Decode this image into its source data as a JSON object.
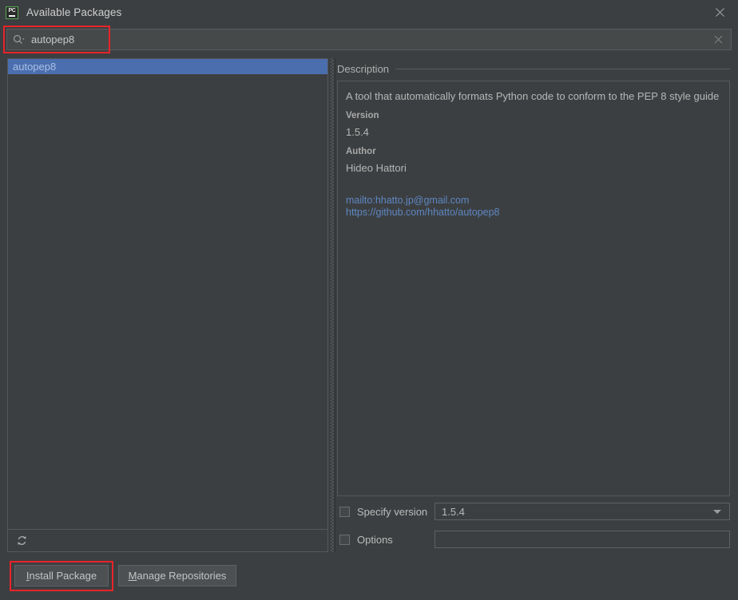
{
  "window": {
    "title": "Available Packages",
    "app_icon": "pycharm-icon",
    "app_icon_text": "PC",
    "close_icon": "close-icon",
    "background_color": "#3c3f41"
  },
  "search": {
    "icon": "search-icon",
    "value": "autopep8",
    "placeholder": "",
    "clear_icon": "clear-icon",
    "highlight_color": "#e8242a"
  },
  "package_list": {
    "items": [
      {
        "label": "autopep8",
        "selected": true
      }
    ],
    "selection_color": "#4b6eaf",
    "toolbar": {
      "refresh_icon": "refresh-icon"
    }
  },
  "description": {
    "header_label": "Description",
    "summary": "A tool that automatically formats Python code to conform to the PEP 8 style guide",
    "fields": [
      {
        "label": "Version",
        "value": "1.5.4"
      },
      {
        "label": "Author",
        "value": "Hideo Hattori"
      }
    ],
    "links": [
      "mailto:hhatto.jp@gmail.com",
      "https://github.com/hhatto/autopep8"
    ],
    "link_color": "#5e87c4"
  },
  "options": {
    "specify_version": {
      "label": "Specify version",
      "checked": false,
      "value": "1.5.4"
    },
    "options_field": {
      "label": "Options",
      "checked": false,
      "value": ""
    }
  },
  "buttons": {
    "install": {
      "mnemonic": "I",
      "rest": "nstall Package",
      "highlighted": true
    },
    "manage": {
      "mnemonic": "M",
      "rest": "anage Repositories",
      "highlighted": false
    }
  }
}
